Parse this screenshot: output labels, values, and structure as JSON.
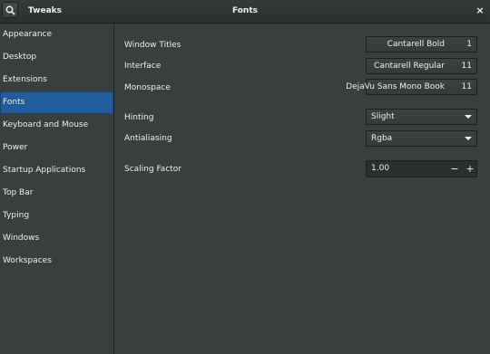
{
  "header": {
    "app_title": "Tweaks",
    "page_title": "Fonts",
    "close_glyph": "×"
  },
  "sidebar": {
    "selected": "Fonts",
    "items": [
      {
        "label": "Appearance"
      },
      {
        "label": "Desktop"
      },
      {
        "label": "Extensions"
      },
      {
        "label": "Fonts"
      },
      {
        "label": "Keyboard and Mouse"
      },
      {
        "label": "Power"
      },
      {
        "label": "Startup Applications"
      },
      {
        "label": "Top Bar"
      },
      {
        "label": "Typing"
      },
      {
        "label": "Windows"
      },
      {
        "label": "Workspaces"
      }
    ]
  },
  "fonts": {
    "window_titles": {
      "label": "Window Titles",
      "font": "Cantarell Bold",
      "size": "1"
    },
    "interface": {
      "label": "Interface",
      "font": "Cantarell Regular",
      "size": "11"
    },
    "monospace": {
      "label": "Monospace",
      "font": "DejaVu Sans Mono Book",
      "size": "11"
    },
    "hinting": {
      "label": "Hinting",
      "value": "Slight"
    },
    "antialiasing": {
      "label": "Antialiasing",
      "value": "Rgba"
    },
    "scaling": {
      "label": "Scaling Factor",
      "value": "1.00",
      "decrement": "−",
      "increment": "+"
    }
  },
  "icons": {
    "search": "search-icon",
    "close": "close-icon",
    "dropdown": "chevron-down-icon"
  },
  "colors": {
    "background": "#393f3f",
    "selected": "#215d9c",
    "text": "#eeeeec"
  }
}
